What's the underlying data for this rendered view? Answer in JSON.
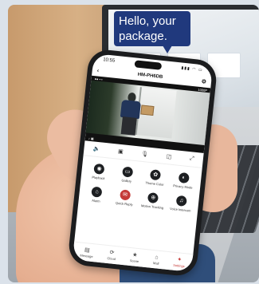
{
  "bubble": {
    "text_line1": "Hello, your",
    "text_line2": "package."
  },
  "phone": {
    "status": {
      "time": "10:55",
      "icons": "▮▮▮ ◠ ▭"
    },
    "title": "HM-PH6DB",
    "back_icon": "‹",
    "settings_icon": "⚙",
    "video": {
      "top_left": "●● ▪ ▪",
      "top_right": "1080P",
      "bottom_left": "♪ ▣"
    },
    "controls": [
      "🔈",
      "▣",
      "🎙",
      "◫",
      "⤢"
    ],
    "features": [
      {
        "icon": "◉",
        "label": "Playback",
        "accent": false
      },
      {
        "icon": "▭",
        "label": "Gallery",
        "accent": false
      },
      {
        "icon": "✿",
        "label": "Theme Color",
        "accent": false
      },
      {
        "icon": "◐",
        "label": "Privacy Mode",
        "accent": false
      },
      {
        "icon": "⌂",
        "label": "Alarm",
        "accent": false
      },
      {
        "icon": "✉",
        "label": "Quick Reply",
        "accent": true
      },
      {
        "icon": "⊕",
        "label": "Motion Tracking",
        "accent": false
      },
      {
        "icon": "♫",
        "label": "Voice Intercom",
        "accent": false
      }
    ],
    "nav": [
      {
        "icon": "▤",
        "label": "Message",
        "active": false
      },
      {
        "icon": "⟳",
        "label": "Cloud",
        "active": false
      },
      {
        "icon": "★",
        "label": "Scene",
        "active": false
      },
      {
        "icon": "⌂",
        "label": "Mall",
        "active": false
      },
      {
        "icon": "✦",
        "label": "Settings",
        "active": true
      }
    ]
  },
  "colors": {
    "bubble": "#20397d",
    "accent": "#c53a37"
  }
}
